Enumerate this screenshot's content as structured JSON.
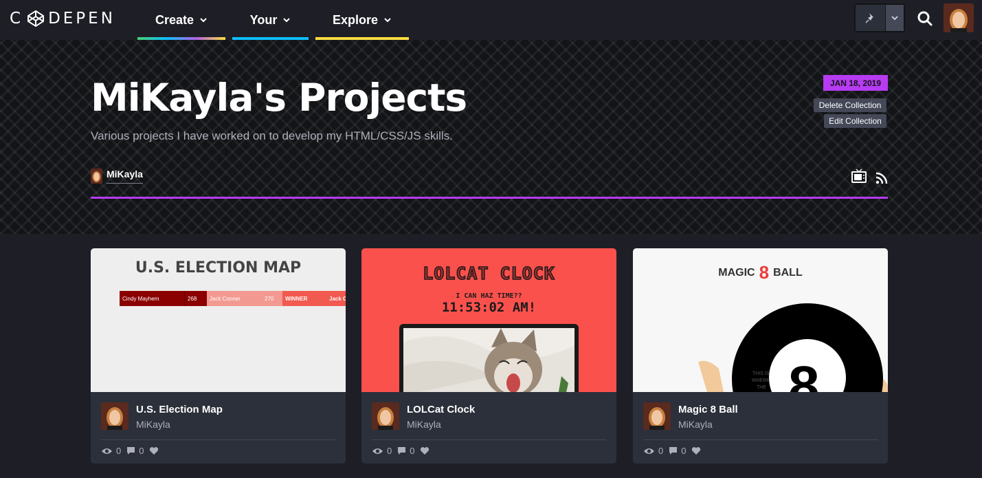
{
  "colors": {
    "nav_bg": "#1e1f26",
    "accent_purple": "#b63bf2",
    "card_bg": "#2c303a",
    "create_bar": "linear-gradient(90deg,#47cf73,#0ebeff,#ae63e4,#ffdd40)",
    "your_bar": "#0ebeff",
    "explore_bar": "#ffdd40"
  },
  "nav": {
    "logo_text": "DEPEN",
    "logo_prefix": "C",
    "items": [
      {
        "label": "Create"
      },
      {
        "label": "Your"
      },
      {
        "label": "Explore"
      }
    ],
    "pin_icon": "pin-icon",
    "search_icon": "search-icon"
  },
  "collection": {
    "title": "MiKayla's Projects",
    "description": "Various projects I have worked on to develop my HTML/CSS/JS skills.",
    "date": "JAN 18, 2019",
    "delete_label": "Delete Collection",
    "edit_label": "Edit Collection",
    "owner": "MiKayla"
  },
  "cards": [
    {
      "title": "U.S. Election Map",
      "author": "MiKayla",
      "views": "0",
      "comments": "0",
      "preview": {
        "heading": "U.S. ELECTION MAP",
        "bar": [
          "Cindy Mayhem",
          "268",
          "Jack Conner",
          "270",
          "WINNER",
          "Jack Co"
        ]
      }
    },
    {
      "title": "LOLCat Clock",
      "author": "MiKayla",
      "views": "0",
      "comments": "0",
      "preview": {
        "heading": "LOLCAT CLOCK",
        "sub": "I CAN HAZ TIME??",
        "time": "11:53:02 AM!"
      }
    },
    {
      "title": "Magic 8 Ball",
      "author": "MiKayla",
      "views": "0",
      "comments": "0",
      "preview": {
        "heading_left": "MAGIC",
        "heading_num": "8",
        "heading_right": "BALL",
        "ball_text": [
          "THIS IS",
          "WHERE",
          "THE"
        ],
        "ball_num": "8"
      }
    }
  ]
}
